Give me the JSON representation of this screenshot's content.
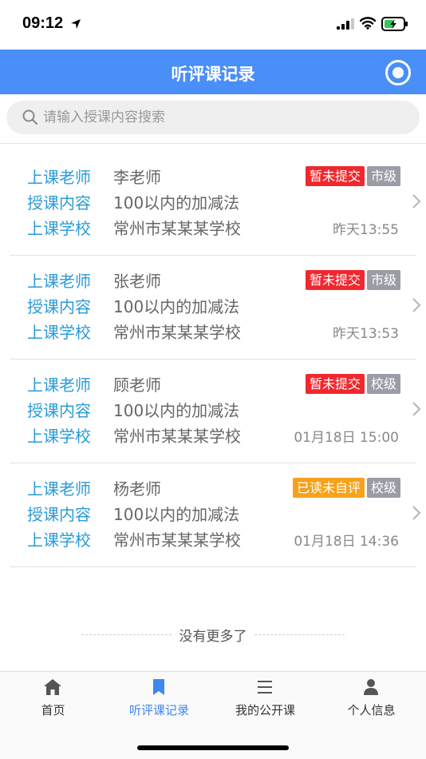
{
  "status_bar": {
    "time": "09:12"
  },
  "header": {
    "title": "听评课记录"
  },
  "search": {
    "placeholder": "请输入授课内容搜索"
  },
  "labels": {
    "teacher": "上课老师",
    "content": "授课内容",
    "school": "上课学校"
  },
  "records": [
    {
      "teacher": "李老师",
      "content": "100以内的加减法",
      "school": "常州市某某某学校",
      "time": "昨天13:55",
      "status": "暂未提交",
      "status_color": "#f0282e",
      "level": "市级"
    },
    {
      "teacher": "张老师",
      "content": "100以内的加减法",
      "school": "常州市某某某学校",
      "time": "昨天13:53",
      "status": "暂未提交",
      "status_color": "#f0282e",
      "level": "市级"
    },
    {
      "teacher": "顾老师",
      "content": "100以内的加减法",
      "school": "常州市某某某学校",
      "time": "01月18日 15:00",
      "status": "暂未提交",
      "status_color": "#f0282e",
      "level": "校级"
    },
    {
      "teacher": "杨老师",
      "content": "100以内的加减法",
      "school": "常州市某某某学校",
      "time": "01月18日 14:36",
      "status": "已读未自评",
      "status_color": "#f6a21c",
      "level": "校级"
    }
  ],
  "footer": {
    "no_more": "没有更多了"
  },
  "tabbar": {
    "items": [
      {
        "label": "首页",
        "icon": "home-icon",
        "active": false
      },
      {
        "label": "听评课记录",
        "icon": "bookmark-icon",
        "active": true
      },
      {
        "label": "我的公开课",
        "icon": "list-icon",
        "active": false
      },
      {
        "label": "个人信息",
        "icon": "person-icon",
        "active": false
      }
    ]
  },
  "colors": {
    "primary": "#4a8ef7",
    "label": "#2a9bd6",
    "red_badge": "#f0282e",
    "orange_badge": "#f6a21c",
    "gray_badge": "#9a9da5"
  }
}
